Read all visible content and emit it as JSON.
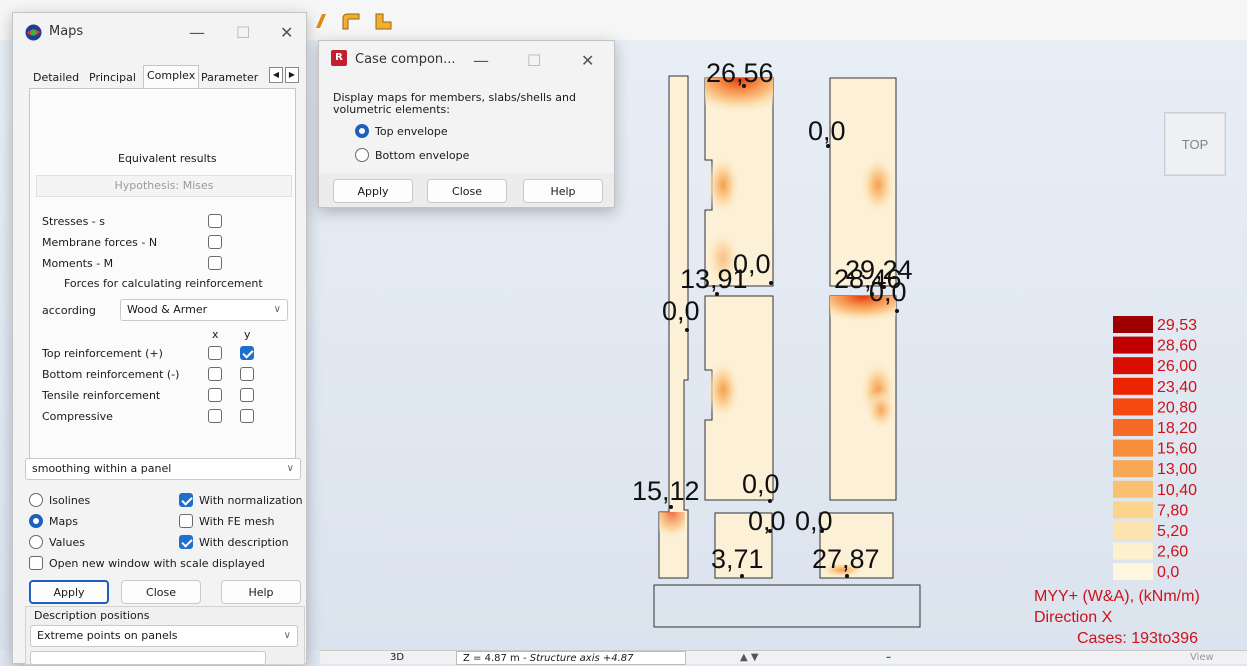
{
  "maps_window": {
    "title": "Maps",
    "tabs": [
      "Detailed",
      "Principal",
      "Complex",
      "Parameter"
    ],
    "active_tab": "Complex",
    "equivalent_results": "Equivalent results",
    "hypothesis": "Hypothesis: Mises",
    "stresses": "Stresses - s",
    "membrane_forces": "Membrane forces - N",
    "moments": "Moments - M",
    "forces_reinforcement": "Forces for calculating reinforcement",
    "according_label": "according",
    "according_value": "Wood & Armer",
    "col_x": "x",
    "col_y": "y",
    "rows": [
      {
        "label": "Top reinforcement (+)",
        "x": false,
        "y": true
      },
      {
        "label": "Bottom reinforcement (-)",
        "x": false,
        "y": false
      },
      {
        "label": "Tensile reinforcement",
        "x": false,
        "y": false
      },
      {
        "label": "Compressive",
        "x": false,
        "y": false
      }
    ],
    "smoothing": "smoothing within a panel",
    "isolines": "Isolines",
    "maps": "Maps",
    "values": "Values",
    "with_normalization": "With normalization",
    "with_fe_mesh": "With FE mesh",
    "with_description": "With description",
    "open_new_window": "Open new window with scale displayed",
    "apply": "Apply",
    "close": "Close",
    "help": "Help",
    "description_positions": "Description positions",
    "extreme_points": "Extreme points on panels"
  },
  "case_window": {
    "title": "Case compon...",
    "description": "Display maps for members, slabs/shells and volumetric elements:",
    "top_envelope": "Top envelope",
    "bottom_envelope": "Bottom envelope",
    "apply": "Apply",
    "close": "Close",
    "help": "Help"
  },
  "viewport": {
    "view_cube": "TOP",
    "labels": [
      "26,56",
      "0,0",
      "13,91",
      "0,0",
      "29,24",
      "28,46",
      "0,0",
      "0,0",
      "15,12",
      "0,0",
      "0,0",
      "0,0",
      "3,71",
      "27,87"
    ]
  },
  "legend": {
    "values": [
      "29,53",
      "28,60",
      "26,00",
      "23,40",
      "20,80",
      "18,20",
      "15,60",
      "13,00",
      "10,40",
      "7,80",
      "5,20",
      "2,60",
      "0,0"
    ],
    "colors": [
      "#9c0000",
      "#c00000",
      "#d80c00",
      "#ee2400",
      "#f44a10",
      "#f66a24",
      "#f78c3a",
      "#f8a854",
      "#fac070",
      "#fcd48e",
      "#fde3ad",
      "#fdf0cc",
      "#fdf7e0"
    ],
    "title": "MYY+ (W&A), (kNm/m)",
    "direction": "Direction X",
    "cases": "Cases: 193to396"
  },
  "statusbar": {
    "mode": "3D",
    "coordinate": "Z = 4.87 m",
    "axis": "Structure axis +4.87",
    "view": "View"
  }
}
